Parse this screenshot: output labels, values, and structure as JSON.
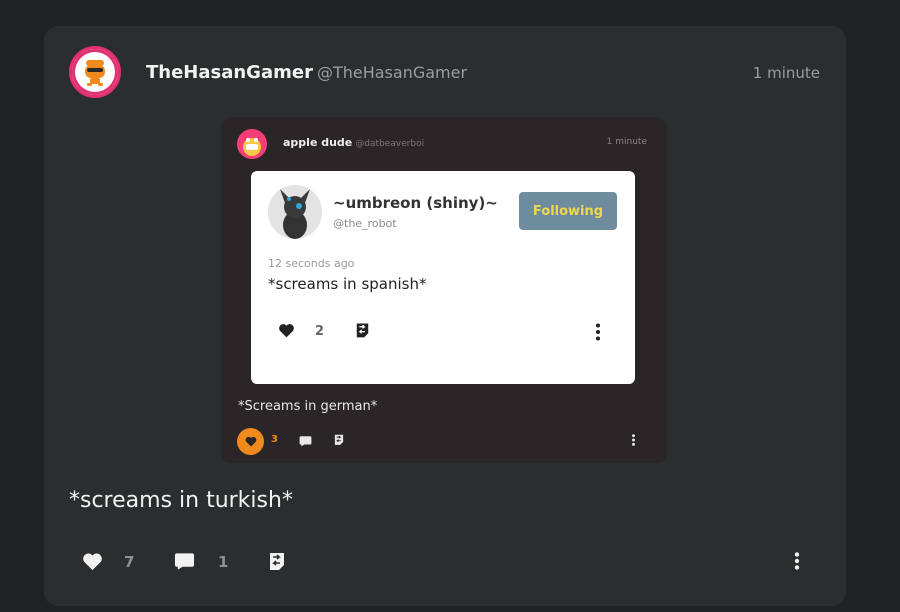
{
  "post": {
    "author_name": "TheHasanGamer",
    "author_handle": "@TheHasanGamer",
    "time": "1 minute",
    "text": "*screams in turkish*",
    "likes": "7",
    "comments": "1"
  },
  "quoted": {
    "author_name": "apple dude",
    "author_handle": "@datbeaverboi",
    "time": "1 minute",
    "text": "*Screams in german*",
    "likes": "3"
  },
  "nested": {
    "author_name": "~umbreon (shiny)~",
    "author_handle": "@the_robot",
    "follow_label": "Following",
    "time": "12 seconds ago",
    "text": "*screams in spanish*",
    "likes": "2"
  },
  "colors": {
    "accent_like": "#f08a1c",
    "follow_bg": "#6e8c9e",
    "follow_text": "#f1d84b",
    "avatar_ring": "#e0306f"
  },
  "icons": [
    "heart-icon",
    "comment-icon",
    "repost-icon",
    "more-vertical-icon"
  ]
}
